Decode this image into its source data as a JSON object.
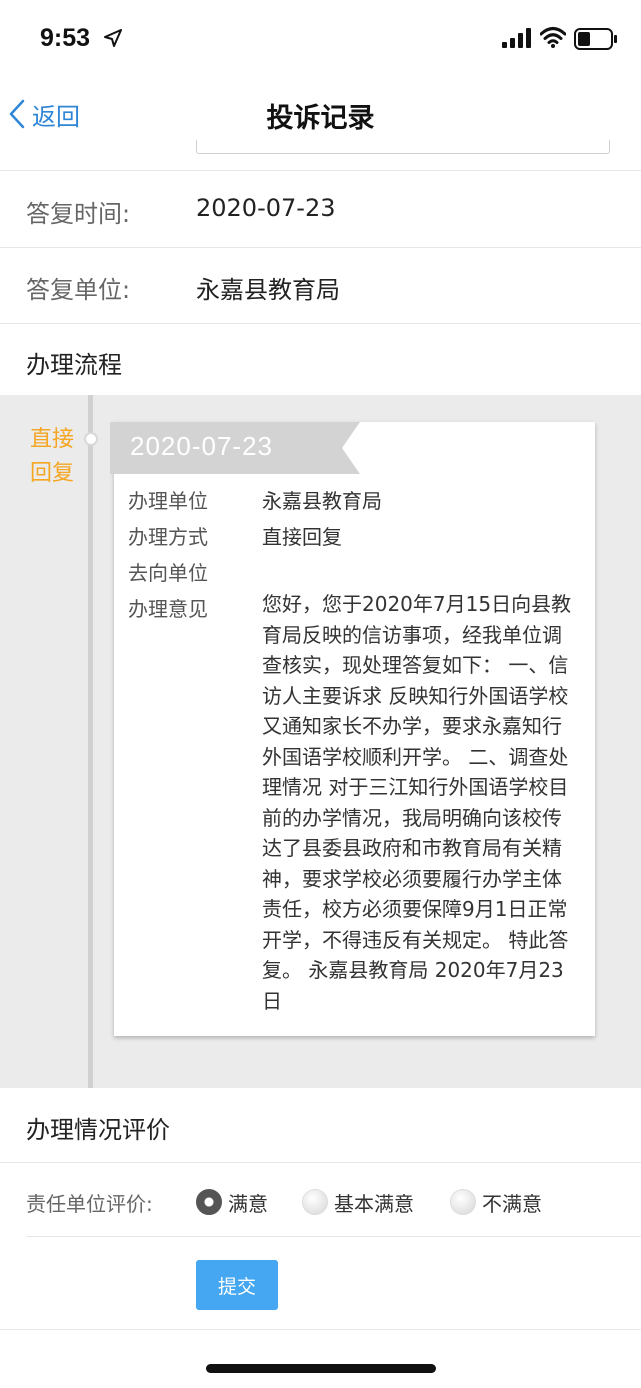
{
  "status": {
    "time": "9:53"
  },
  "nav": {
    "back_label": "返回",
    "title": "投诉记录"
  },
  "reply_info": [
    {
      "label": "答复时间:",
      "value": "2020-07-23"
    },
    {
      "label": "答复单位:",
      "value": "永嘉县教育局"
    }
  ],
  "process": {
    "header": "办理流程",
    "tag_line1": "直接",
    "tag_line2": "回复",
    "date": "2020-07-23",
    "fields": [
      {
        "label": "办理单位",
        "value": "永嘉县教育局"
      },
      {
        "label": "办理方式",
        "value": "直接回复"
      },
      {
        "label": "去向单位",
        "value": ""
      },
      {
        "label": "办理意见",
        "value": "您好，您于2020年7月15日向县教育局反映的信访事项，经我单位调查核实，现处理答复如下： 一、信访人主要诉求 反映知行外国语学校又通知家长不办学，要求永嘉知行外国语学校顺利开学。 二、调查处理情况 对于三江知行外国语学校目前的办学情况，我局明确向该校传达了县委县政府和市教育局有关精神，要求学校必须要履行办学主体责任，校方必须要保障9月1日正常开学，不得违反有关规定。 特此答复。 永嘉县教育局 2020年7月23日"
      }
    ]
  },
  "evaluation": {
    "header": "办理情况评价",
    "label": "责任单位评价:",
    "options": [
      {
        "label": "满意",
        "selected": true
      },
      {
        "label": "基本满意",
        "selected": false
      },
      {
        "label": "不满意",
        "selected": false
      }
    ],
    "submit_label": "提交"
  },
  "colors": {
    "accent_blue": "#2f86d6",
    "tag_orange": "#f5a623",
    "button_blue": "#45a6f2",
    "timeline_bg": "#ebebeb",
    "ribbon_gray": "#d3d3d3"
  }
}
